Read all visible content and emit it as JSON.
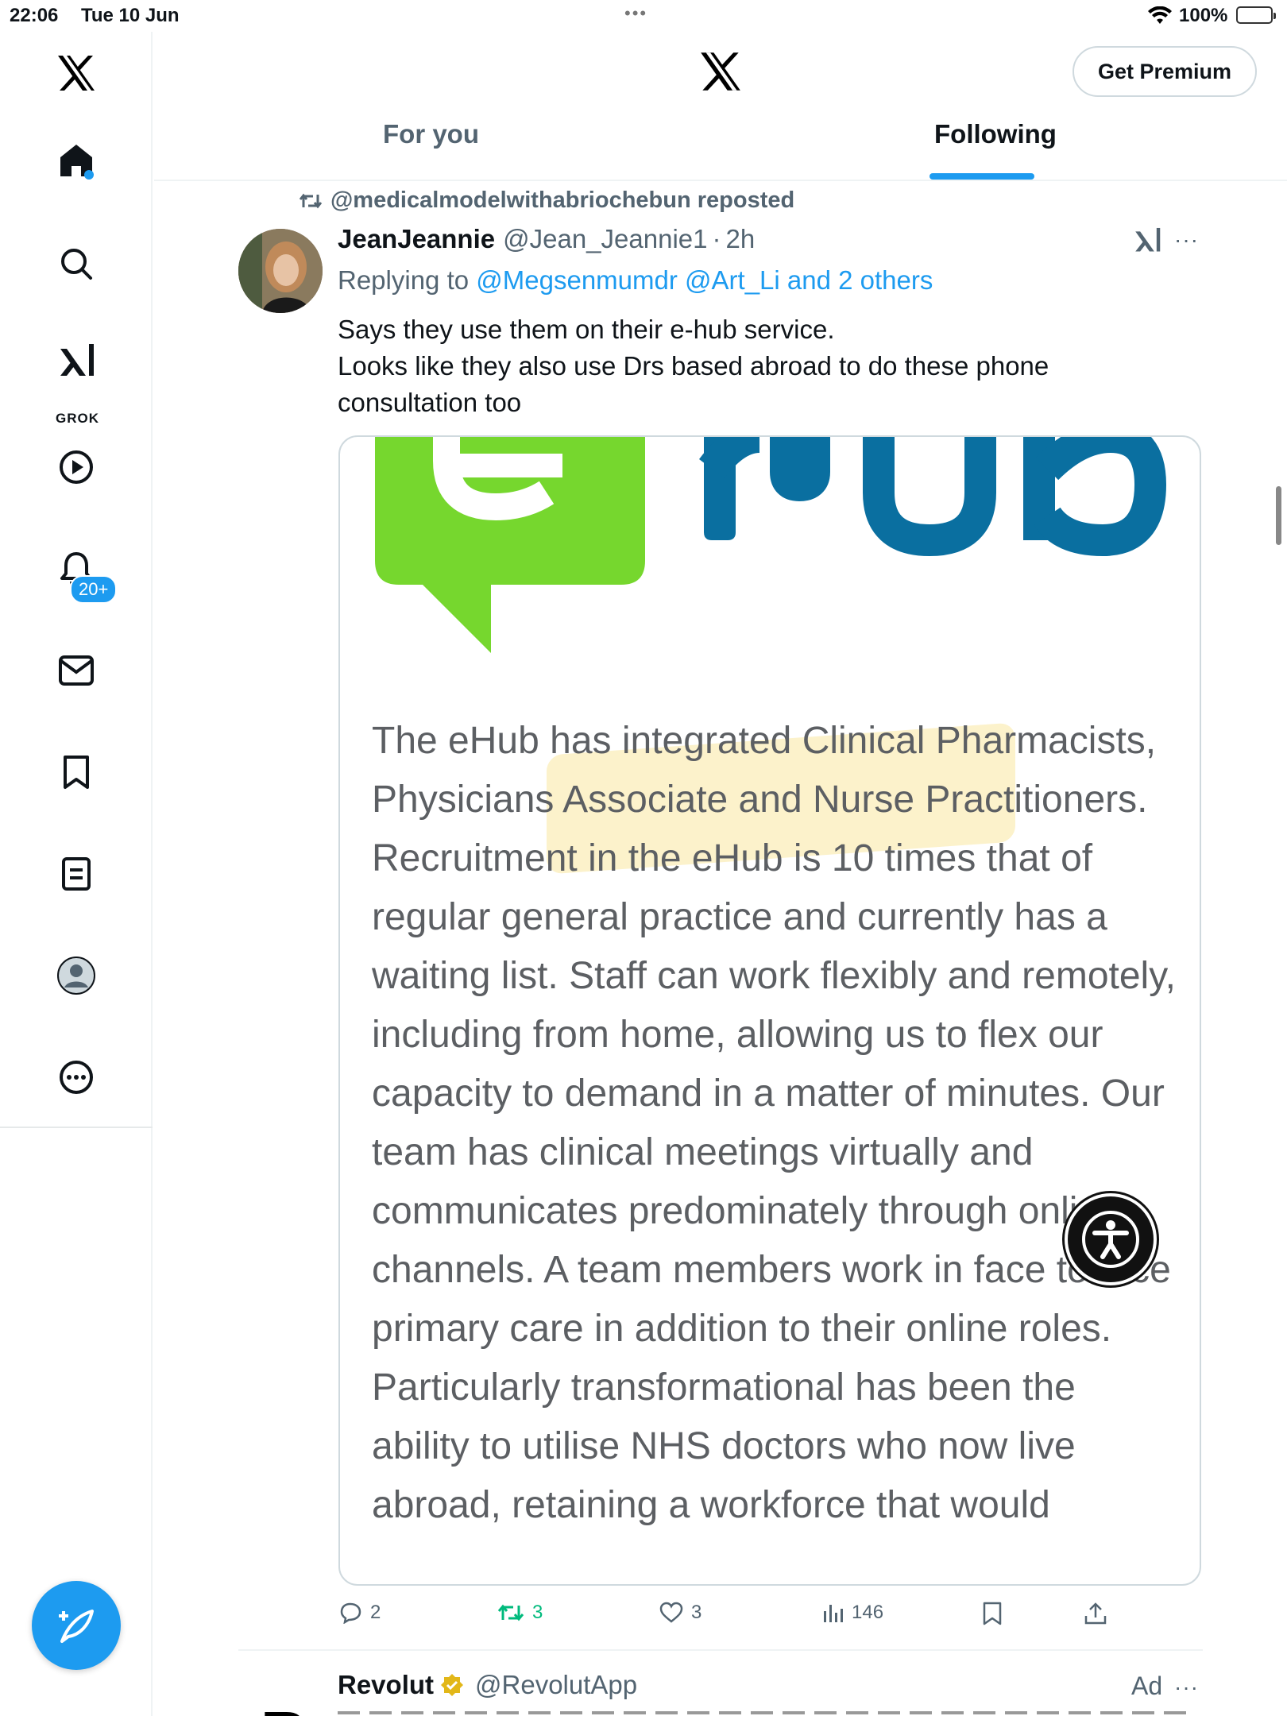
{
  "status_bar": {
    "time": "22:06",
    "date": "Tue 10 Jun",
    "dots": "•••",
    "battery_percent": "100%"
  },
  "sidebar": {
    "items": [
      {
        "name": "x-logo-icon"
      },
      {
        "name": "home-icon"
      },
      {
        "name": "search-icon"
      },
      {
        "name": "grok-icon",
        "label": "GROK"
      },
      {
        "name": "video-icon"
      },
      {
        "name": "notifications-icon",
        "badge": "20+"
      },
      {
        "name": "messages-icon"
      },
      {
        "name": "bookmarks-icon"
      },
      {
        "name": "lists-icon"
      },
      {
        "name": "profile-icon"
      },
      {
        "name": "more-icon"
      }
    ]
  },
  "header": {
    "premium_label": "Get Premium",
    "tabs": [
      {
        "label": "For you",
        "active": false
      },
      {
        "label": "Following",
        "active": true
      }
    ]
  },
  "tweet": {
    "repost_text": "@medicalmodelwithabriochebun reposted",
    "name": "JeanJeannie",
    "handle": "@Jean_Jeannie1",
    "separator": "·",
    "time": "2h",
    "replying_prefix": "Replying to",
    "replying_targets": "@Megsenmumdr @Art_Li and 2 others",
    "text_line1": "Says they use them on their e-hub service.",
    "text_line2": "Looks like they also use Drs based abroad to do these phone consultation too",
    "media": {
      "paragraph": "The eHub has integrated Clinical Pharmacists, Physicians Associate and Nurse Practitioners. Recruitment in the eHub is 10 times that of regular general practice and currently has a waiting list. Staff can work flexibly and remotely, including from home, allowing us to flex our capacity to demand in a matter of minutes. Our team has clinical meetings virtually and communicates predominately through online channels. A team members work in face to face primary care in addition to their online roles. Particularly transformational has been the ability to utilise NHS doctors who now live abroad, retaining a workforce that would"
    },
    "actions": {
      "replies": "2",
      "reposts": "3",
      "likes": "3",
      "views": "146"
    }
  },
  "next_tweet": {
    "name": "Revolut",
    "handle": "@RevolutApp",
    "ad_label": "Ad"
  },
  "colors": {
    "accent": "#1d9bf0",
    "repost_green": "#00ba7c",
    "ehub_green": "#76d72e",
    "ehub_blue": "#0a6fa0",
    "highlight": "#fcf0c2"
  }
}
